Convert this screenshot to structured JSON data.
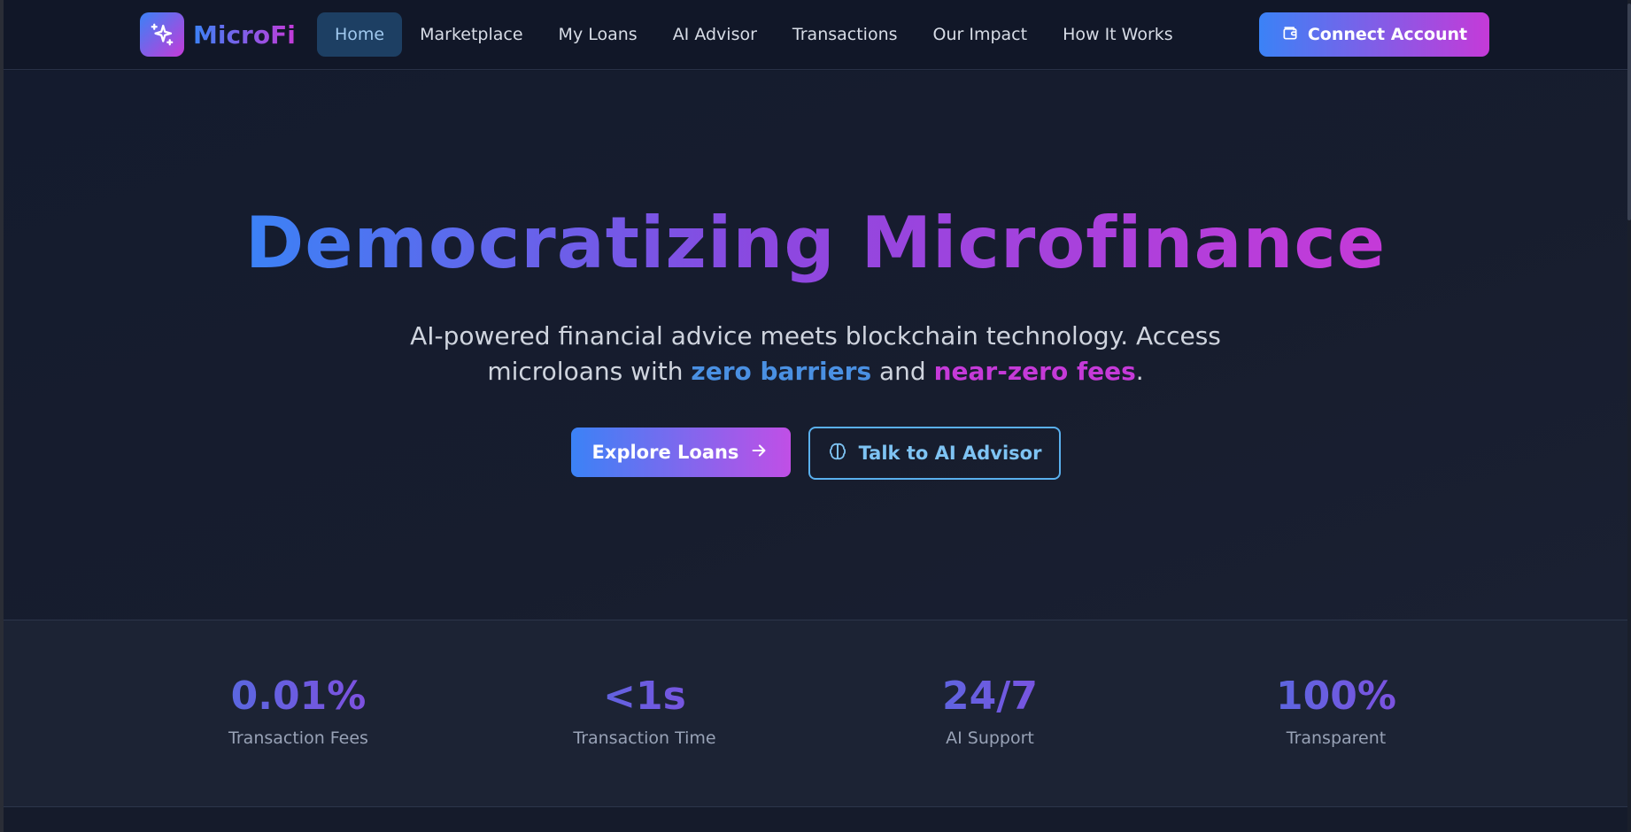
{
  "brand": {
    "name": "MicroFi",
    "icon": "sparkles-icon",
    "gradient_start": "#3b82f6",
    "gradient_end": "#c53ad8"
  },
  "nav": {
    "items": [
      {
        "label": "Home",
        "active": true
      },
      {
        "label": "Marketplace",
        "active": false
      },
      {
        "label": "My Loans",
        "active": false
      },
      {
        "label": "AI Advisor",
        "active": false
      },
      {
        "label": "Transactions",
        "active": false
      },
      {
        "label": "Our Impact",
        "active": false
      },
      {
        "label": "How It Works",
        "active": false
      }
    ],
    "connect_label": "Connect Account",
    "connect_icon": "wallet-icon"
  },
  "hero": {
    "title": "Democratizing Microfinance",
    "subtitle_pre": "AI-powered financial advice meets blockchain technology. Access microloans with ",
    "subtitle_hl1": "zero barriers",
    "subtitle_mid": " and ",
    "subtitle_hl2": "near-zero fees",
    "subtitle_post": ".",
    "primary_cta": "Explore Loans",
    "primary_icon": "arrow-right-icon",
    "secondary_cta": "Talk to AI Advisor",
    "secondary_icon": "brain-icon"
  },
  "stats": [
    {
      "value": "0.01%",
      "label": "Transaction Fees"
    },
    {
      "value": "<1s",
      "label": "Transaction Time"
    },
    {
      "value": "24/7",
      "label": "AI Support"
    },
    {
      "value": "100%",
      "label": "Transparent"
    }
  ]
}
